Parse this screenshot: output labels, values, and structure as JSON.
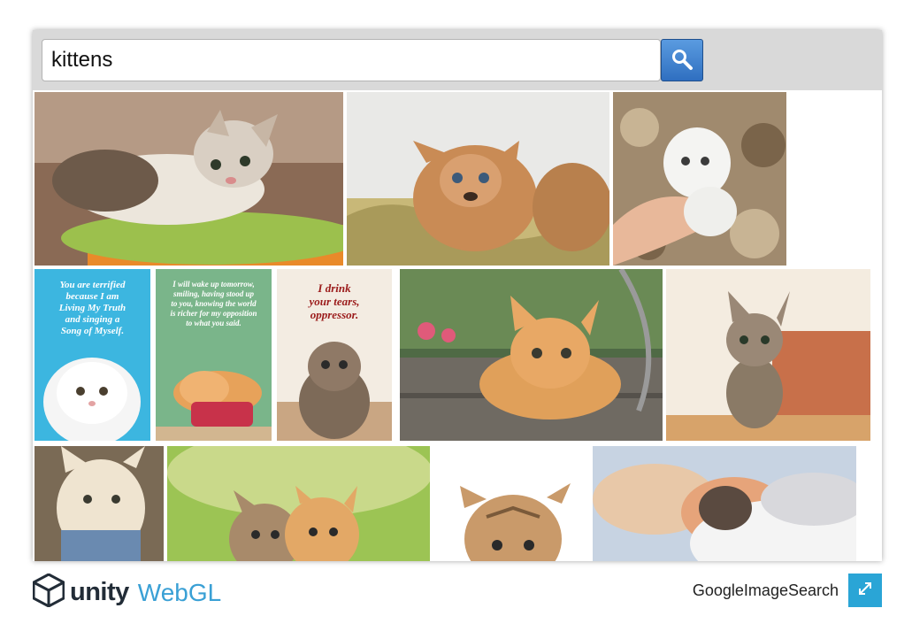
{
  "search": {
    "query": "kittens",
    "button_icon": "search-icon"
  },
  "results": {
    "images": [
      {
        "id": "result-1",
        "subject": "tabby-white-kitten-lying",
        "alt": "kitten"
      },
      {
        "id": "result-2",
        "subject": "caracal-kitten-in-grass",
        "alt": "kitten"
      },
      {
        "id": "result-3",
        "subject": "white-kitten-on-hand",
        "alt": "kitten"
      },
      {
        "id": "result-4",
        "subject": "quote-card-white-persian",
        "alt": "kitten",
        "caption": "You are terrified\nbecause I am\nLiving My Truth\nand singing a\nSong of Myself."
      },
      {
        "id": "result-5",
        "subject": "quote-card-sleeping-kitten",
        "alt": "kitten",
        "caption": "I will wake up tomorrow,\nsmiling, having stood up\nto you, knowing the world\nis richer for my opposition\nto what you said."
      },
      {
        "id": "result-6",
        "subject": "quote-card-scottish-fold",
        "alt": "kitten",
        "caption": "I drink\nyour tears,\noppressor."
      },
      {
        "id": "result-7",
        "subject": "orange-kitten-on-deck",
        "alt": "kitten"
      },
      {
        "id": "result-8",
        "subject": "tabby-kitten-sitting",
        "alt": "kitten"
      },
      {
        "id": "result-9",
        "subject": "fluffy-cream-kitten",
        "alt": "kitten"
      },
      {
        "id": "result-10",
        "subject": "two-kittens-green-background",
        "alt": "kitten"
      },
      {
        "id": "result-11",
        "subject": "tabby-kitten-white-background",
        "alt": "kitten"
      },
      {
        "id": "result-12",
        "subject": "sleeping-kittens-pile",
        "alt": "kitten"
      }
    ]
  },
  "footer": {
    "brand_unity": "unity",
    "brand_webgl": "WebGL",
    "project_title": "GoogleImageSearch",
    "fullscreen_icon": "fullscreen-icon"
  },
  "colors": {
    "search_button": "#3a7fcf",
    "webgl_accent": "#3aa0d5",
    "fullscreen_button": "#2aa5d6",
    "unity_dark": "#222c37"
  }
}
